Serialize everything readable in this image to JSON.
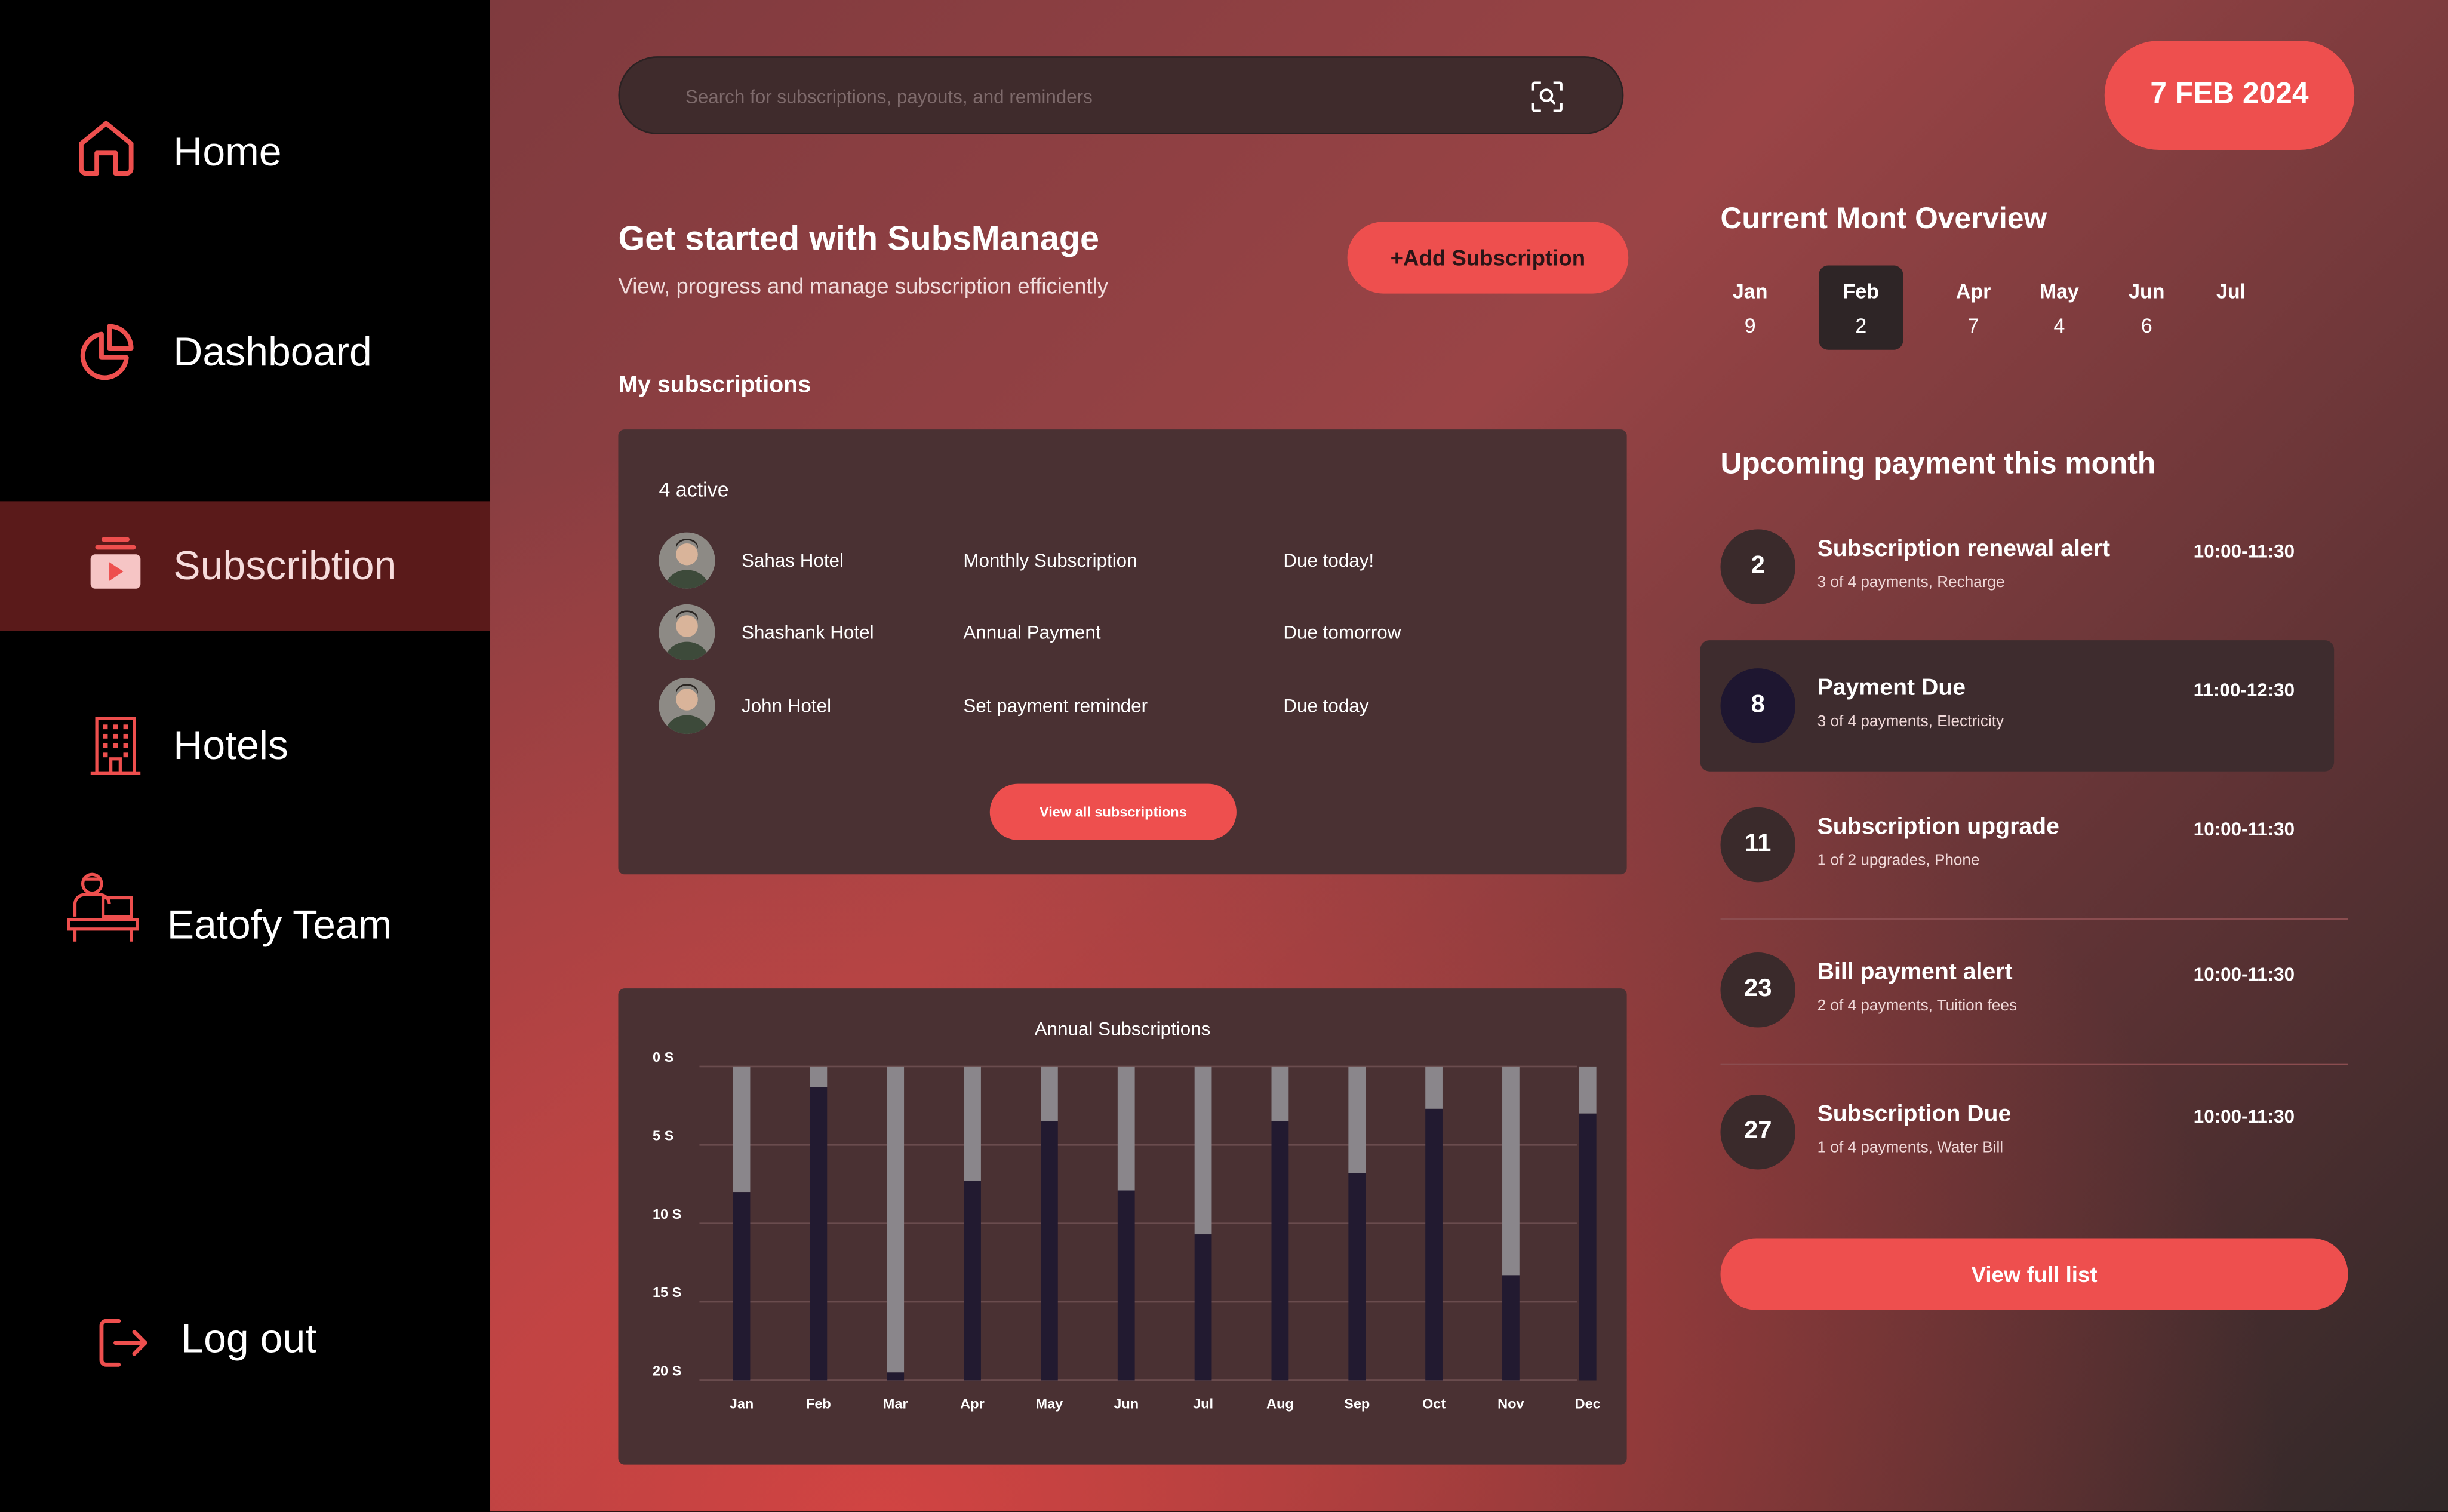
{
  "sidebar": {
    "items": [
      {
        "label": "Home",
        "icon": "home-icon"
      },
      {
        "label": "Dashboard",
        "icon": "pie-chart-icon"
      },
      {
        "label": "Subscribtion",
        "icon": "subscription-icon",
        "active": true
      },
      {
        "label": "Hotels",
        "icon": "building-icon"
      },
      {
        "label": "Eatofy Team",
        "icon": "team-member-icon"
      }
    ],
    "logout": {
      "label": "Log out",
      "icon": "logout-icon"
    }
  },
  "search": {
    "placeholder": "Search for subscriptions, payouts, and reminders",
    "icon": "scan-search-icon"
  },
  "date": "7 FEB 2024",
  "intro": {
    "title": "Get started with SubsManage",
    "subtitle": "View, progress and manage subscription efficiently",
    "add_button": "+Add Subscription"
  },
  "subscriptions": {
    "heading": "My subscriptions",
    "active": "4 active",
    "rows": [
      {
        "name": "Sahas Hotel",
        "type": "Monthly Subscription",
        "due": "Due today!"
      },
      {
        "name": "Shashank Hotel",
        "type": "Annual Payment",
        "due": "Due tomorrow"
      },
      {
        "name": "John Hotel",
        "type": "Set payment reminder",
        "due": "Due today"
      }
    ],
    "view_all": "View all subscriptions"
  },
  "chart_data": {
    "type": "bar",
    "title": "Annual Subscriptions",
    "categories": [
      "Jan",
      "Feb",
      "Mar",
      "Apr",
      "May",
      "Jun",
      "Jul",
      "Aug",
      "Sep",
      "Oct",
      "Nov",
      "Dec"
    ],
    "series": [
      {
        "values": [
          12,
          18.7,
          0.5,
          12.7,
          16.5,
          12.1,
          9.3,
          16.5,
          13.2,
          17.3,
          6.7,
          17
        ]
      },
      {
        "values": [
          8,
          1.3,
          19.5,
          7.3,
          3.5,
          7.9,
          10.7,
          3.5,
          6.8,
          2.7,
          13.3,
          3
        ]
      }
    ],
    "yticks": [
      "0 S",
      "5 S",
      "10 S",
      "15 S",
      "20 S"
    ],
    "ylim": [
      0,
      20
    ],
    "y_inverted": true,
    "colors": {
      "dark": "#221a30",
      "light": "#8a868b",
      "grid": "#6a4c4e"
    },
    "grid": true
  },
  "overview": {
    "title": "Current Mont Overview",
    "months": [
      {
        "m": "Jan",
        "n": "9"
      },
      {
        "m": "Feb",
        "n": "2",
        "selected": true
      },
      {
        "m": "Apr",
        "n": "7"
      },
      {
        "m": "May",
        "n": "4"
      },
      {
        "m": "Jun",
        "n": "6"
      },
      {
        "m": "Jul",
        "n": ""
      }
    ]
  },
  "upcoming": {
    "title": "Upcoming payment this month",
    "items": [
      {
        "day": "2",
        "title": "Subscription renewal alert",
        "sub": "3 of 4 payments, Recharge",
        "time": "10:00-11:30"
      },
      {
        "day": "8",
        "title": "Payment Due",
        "sub": "3 of 4 payments, Electricity",
        "time": "11:00-12:30",
        "highlight": true
      },
      {
        "day": "11",
        "title": "Subscription upgrade",
        "sub": "1 of 2 upgrades, Phone",
        "time": "10:00-11:30"
      },
      {
        "day": "23",
        "title": "Bill payment alert",
        "sub": "2 of 4 payments, Tuition fees",
        "time": "10:00-11:30"
      },
      {
        "day": "27",
        "title": "Subscription Due",
        "sub": "1 of 4 payments, Water Bill",
        "time": "10:00-11:30"
      }
    ],
    "full_list": "View full list"
  },
  "colors": {
    "accent": "#ee4f4e",
    "sidebar": "#000000",
    "active_nav": "#5a1a1a",
    "card": "#4a3133"
  }
}
